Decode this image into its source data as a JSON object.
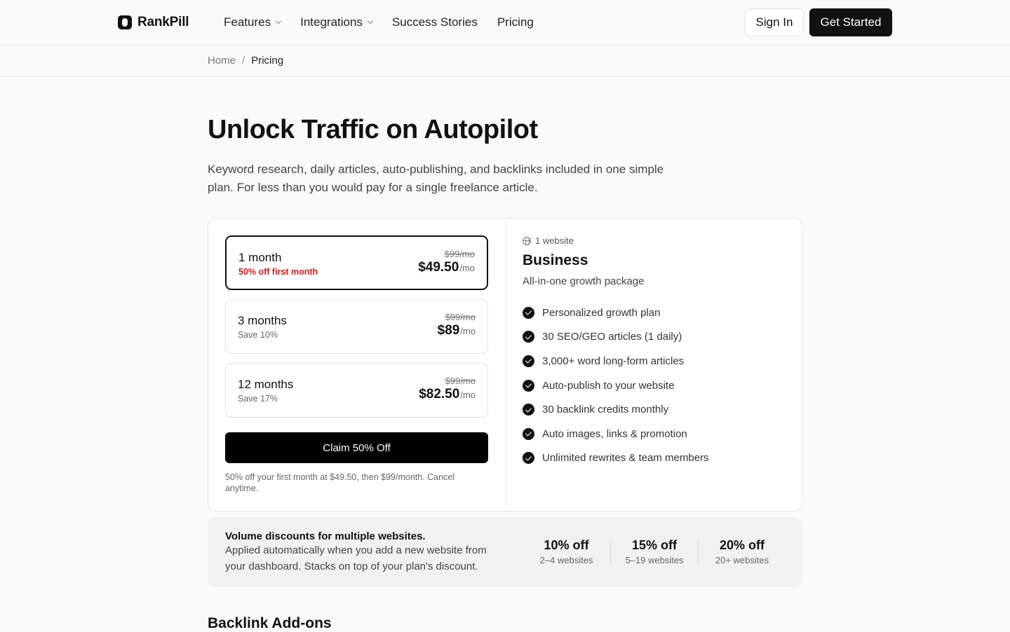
{
  "header": {
    "brand": "RankPill",
    "nav": [
      {
        "label": "Features",
        "dropdown": true
      },
      {
        "label": "Integrations",
        "dropdown": true
      },
      {
        "label": "Success Stories",
        "dropdown": false
      },
      {
        "label": "Pricing",
        "dropdown": false
      }
    ],
    "sign_in": "Sign In",
    "get_started": "Get Started"
  },
  "breadcrumb": {
    "home": "Home",
    "separator": "/",
    "current": "Pricing"
  },
  "hero": {
    "title": "Unlock Traffic on Autopilot",
    "subtitle": "Keyword research, daily articles, auto-publishing, and backlinks included in one simple plan. For less than you would pay for a single freelance article."
  },
  "plans": [
    {
      "name": "1 month",
      "note": "50% off first month",
      "old_price": "$99/mo",
      "price": "$49.50",
      "unit": "/mo",
      "selected": true
    },
    {
      "name": "3 months",
      "note": "Save 10%",
      "old_price": "$99/mo",
      "price": "$89",
      "unit": "/mo",
      "selected": false
    },
    {
      "name": "12 months",
      "note": "Save 17%",
      "old_price": "$99/mo",
      "price": "$82.50",
      "unit": "/mo",
      "selected": false
    }
  ],
  "cta": {
    "label": "Claim 50% Off",
    "fine_print": "50% off your first month at $49.50, then $99/month. Cancel anytime."
  },
  "tier": {
    "sites": "1 website",
    "name": "Business",
    "description": "All-in-one growth package",
    "features": [
      "Personalized growth plan",
      "30 SEO/GEO articles (1 daily)",
      "3,000+ word long-form articles",
      "Auto-publish to your website",
      "30 backlink credits monthly",
      "Auto images, links & promotion",
      "Unlimited rewrites & team members"
    ]
  },
  "volume": {
    "title": "Volume discounts for multiple websites.",
    "description": "Applied automatically when you add a new website from your dashboard. Stacks on top of your plan's discount.",
    "tiers": [
      {
        "discount": "10% off",
        "range": "2–4 websites"
      },
      {
        "discount": "15% off",
        "range": "5–19 websites"
      },
      {
        "discount": "20% off",
        "range": "20+ websites"
      }
    ]
  },
  "addons": {
    "title": "Backlink Add-ons"
  },
  "colors": {
    "accent": "#111111",
    "discount_red": "#c81e1e",
    "background": "#fafafa"
  }
}
